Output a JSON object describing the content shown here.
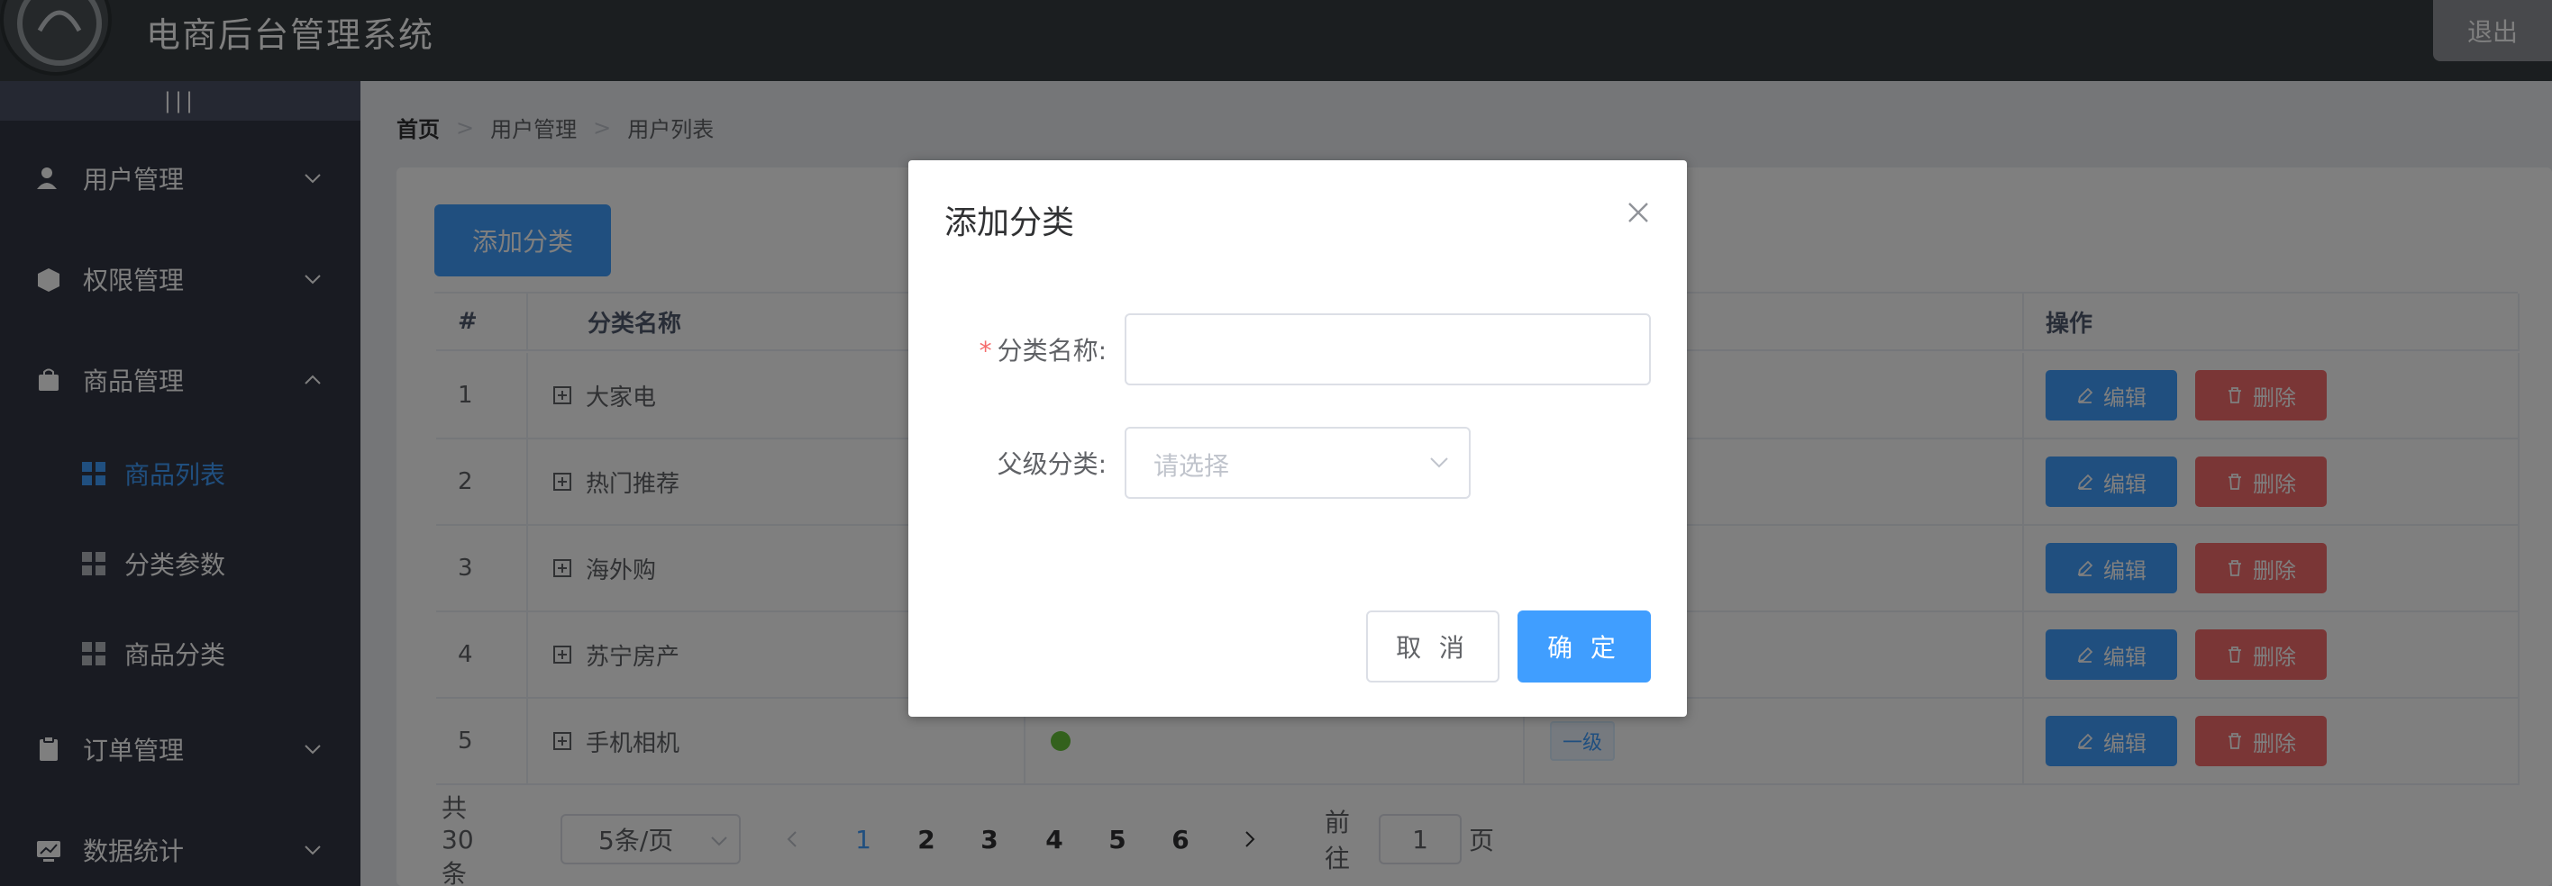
{
  "app": {
    "title": "电商后台管理系统",
    "logout_label": "退出"
  },
  "sidebar": {
    "toggle_label": "|||",
    "menus": [
      {
        "label": "用户管理",
        "icon": "user-icon"
      },
      {
        "label": "权限管理",
        "icon": "box-icon"
      },
      {
        "label": "商品管理",
        "icon": "bag-icon",
        "expanded": true
      },
      {
        "label": "订单管理",
        "icon": "clipboard-icon"
      },
      {
        "label": "数据统计",
        "icon": "chart-icon"
      }
    ],
    "sub_items": [
      {
        "label": "商品列表",
        "active": true
      },
      {
        "label": "分类参数"
      },
      {
        "label": "商品分类"
      }
    ]
  },
  "breadcrumb": {
    "home": "首页",
    "level1": "用户管理",
    "level2": "用户列表",
    "separator": ">"
  },
  "toolbar": {
    "add_label": "添加分类"
  },
  "table": {
    "headers": {
      "index": "#",
      "name": "分类名称",
      "actions": "操作"
    },
    "rows": [
      {
        "index": "1",
        "name": "大家电"
      },
      {
        "index": "2",
        "name": "热门推荐"
      },
      {
        "index": "3",
        "name": "海外购"
      },
      {
        "index": "4",
        "name": "苏宁房产"
      },
      {
        "index": "5",
        "name": "手机相机",
        "level_tag": "一级"
      }
    ],
    "edit_label": "编辑",
    "delete_label": "删除"
  },
  "pagination": {
    "total_text": "共 30 条",
    "page_size": "5条/页",
    "pages": [
      "1",
      "2",
      "3",
      "4",
      "5",
      "6"
    ],
    "current": "1",
    "goto_prefix": "前往",
    "goto_value": "1",
    "goto_suffix": "页"
  },
  "dialog": {
    "title": "添加分类",
    "name_label": "分类名称:",
    "required_mark": "*",
    "name_value": "",
    "parent_label": "父级分类:",
    "parent_placeholder": "请选择",
    "cancel_label": "取 消",
    "confirm_label": "确 定"
  },
  "colors": {
    "primary": "#409eff",
    "danger": "#f56c6c",
    "success": "#67c23a",
    "header": "#373d41",
    "sidebar": "#333744"
  }
}
